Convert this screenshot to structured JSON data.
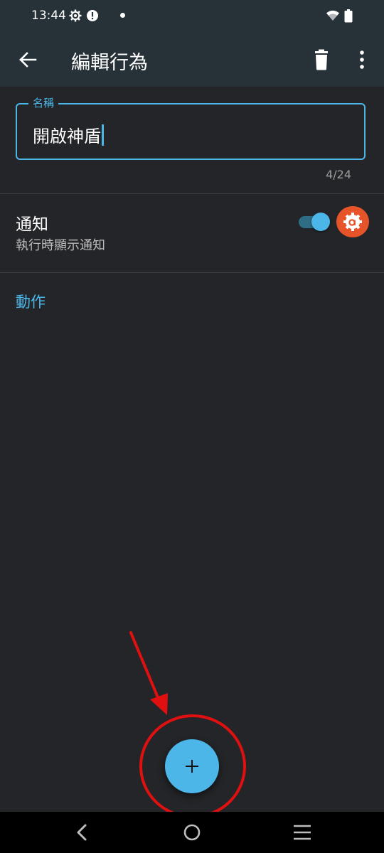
{
  "status_bar": {
    "time": "13:44",
    "icons": [
      "settings-gear-icon",
      "alert-icon",
      "notification-dot-icon",
      "wifi-icon",
      "battery-icon"
    ]
  },
  "toolbar": {
    "title": "編輯行為",
    "back_icon": "arrow-back-icon",
    "delete_icon": "trash-icon",
    "more_icon": "more-vert-icon"
  },
  "form": {
    "name_field": {
      "label": "名稱",
      "value": "開啟神盾",
      "counter": "4/24"
    },
    "notify": {
      "title": "通知",
      "subtitle": "執行時顯示通知",
      "enabled": true,
      "badge_icon": "automate-a-gear-icon"
    },
    "actions_header": "動作"
  },
  "fab": {
    "icon": "plus-icon"
  },
  "nav_bar": {
    "icons": [
      "nav-back-icon",
      "nav-home-icon",
      "nav-menu-icon"
    ]
  },
  "colors": {
    "accent": "#4db6e8",
    "toolbar_bg": "#263238",
    "screen_bg": "#242528",
    "badge": "#e8542a",
    "annotation_red": "#e01010"
  }
}
